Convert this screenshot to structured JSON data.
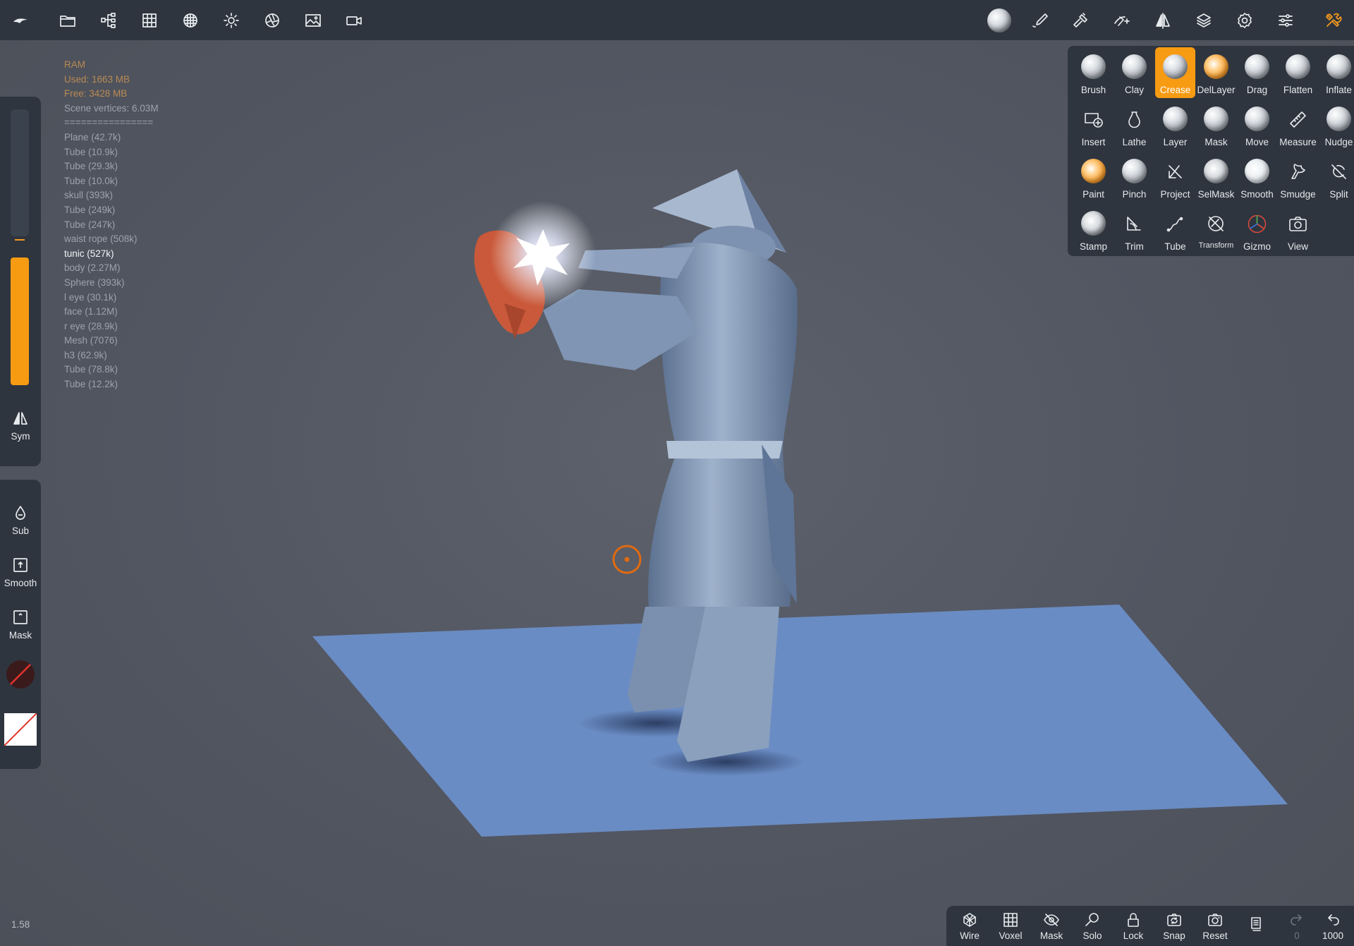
{
  "topbar": {
    "left_icons": [
      "logo-icon",
      "folder-icon",
      "scene-tree-icon",
      "grid-icon",
      "material-icon",
      "light-icon",
      "camera-aperture-icon",
      "background-image-icon",
      "video-camera-icon"
    ],
    "right_icons": [
      "material-sphere-icon",
      "paint-brush-icon",
      "hammer-icon",
      "stroke-settings-icon",
      "symmetry-icon",
      "layers-icon",
      "settings-gear-icon",
      "sliders-icon",
      "tools-icon"
    ]
  },
  "stats": {
    "ram_label": "RAM",
    "used": "Used: 1663 MB",
    "free": "Free: 3428 MB",
    "scene_vertices": "Scene vertices: 6.03M",
    "separator": "================",
    "objects": [
      "Plane (42.7k)",
      "Tube (10.9k)",
      "Tube (29.3k)",
      "Tube (10.0k)",
      "skull (393k)",
      "Tube (249k)",
      "Tube (247k)",
      "waist rope (508k)",
      "tunic (527k)",
      "body (2.27M)",
      "Sphere (393k)",
      "l eye (30.1k)",
      "face (1.12M)",
      "r eye (28.9k)",
      "Mesh (7076)",
      "h3 (62.9k)",
      "Tube (78.8k)",
      "Tube (12.2k)"
    ],
    "selected_object": "tunic (527k)"
  },
  "leftbar": {
    "sym": "Sym",
    "sub": "Sub",
    "smooth": "Smooth",
    "mask": "Mask",
    "radius_slider_level": 0.0,
    "intensity_slider_level": 1.0
  },
  "version": "1.58",
  "tools": [
    {
      "label": "Brush"
    },
    {
      "label": "Clay"
    },
    {
      "label": "Crease"
    },
    {
      "label": "DelLayer"
    },
    {
      "label": "Drag"
    },
    {
      "label": "Flatten"
    },
    {
      "label": "Inflate"
    },
    {
      "label": "Insert"
    },
    {
      "label": "Lathe"
    },
    {
      "label": "Layer"
    },
    {
      "label": "Mask"
    },
    {
      "label": "Move"
    },
    {
      "label": "Measure"
    },
    {
      "label": "Nudge"
    },
    {
      "label": "Paint"
    },
    {
      "label": "Pinch"
    },
    {
      "label": "Project"
    },
    {
      "label": "SelMask"
    },
    {
      "label": "Smooth"
    },
    {
      "label": "Smudge"
    },
    {
      "label": "Split"
    },
    {
      "label": "Stamp"
    },
    {
      "label": "Trim"
    },
    {
      "label": "Tube"
    },
    {
      "label": "Transform"
    },
    {
      "label": "Gizmo"
    },
    {
      "label": "View"
    }
  ],
  "active_tool": "Crease",
  "colors": {
    "accent": "#f79b13",
    "panel": "#2e353f",
    "viewport": "#525661",
    "plane": "#6a8cc4",
    "model": "#7f95b3",
    "head": "#c9593a"
  },
  "bottombar": {
    "wire": "Wire",
    "voxel": "Voxel",
    "mask": "Mask",
    "solo": "Solo",
    "lock": "Lock",
    "snap": "Snap",
    "reset": "Reset",
    "redo_count": "0",
    "undo_count": "1000"
  }
}
